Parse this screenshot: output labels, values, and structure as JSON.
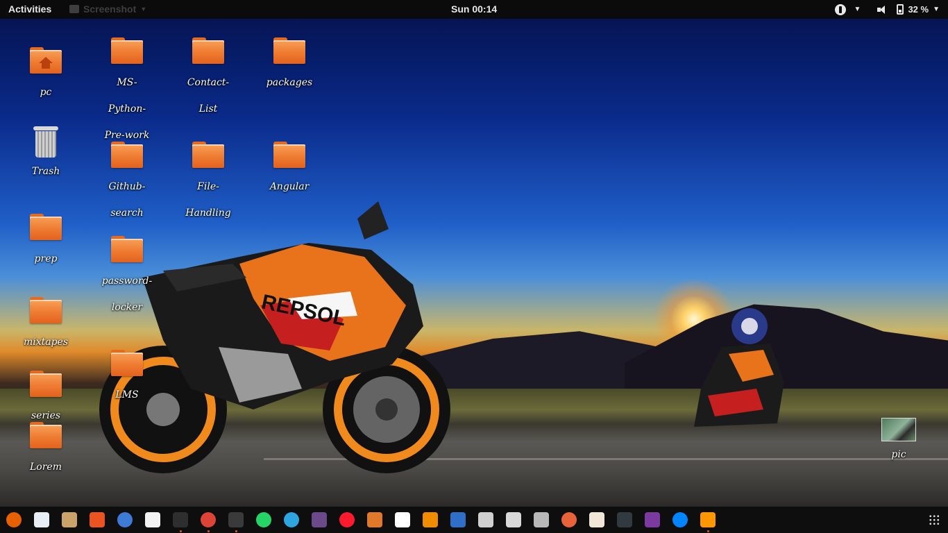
{
  "topbar": {
    "activities": "Activities",
    "app_menu": "Screenshot",
    "clock": "Sun 00:14",
    "battery": "32 %"
  },
  "desktop": {
    "icons": [
      {
        "label": "pc",
        "kind": "home-folder"
      },
      {
        "label": "Trash",
        "kind": "trash"
      },
      {
        "label": "prep",
        "kind": "folder"
      },
      {
        "label": "mixtapes",
        "kind": "folder"
      },
      {
        "label": "series",
        "kind": "folder"
      },
      {
        "label": "Lorem",
        "kind": "folder"
      },
      {
        "label": "MS-\nPython-\nPre-work",
        "kind": "folder"
      },
      {
        "label": "Github-\nsearch",
        "kind": "folder"
      },
      {
        "label": "password-\nlocker",
        "kind": "folder"
      },
      {
        "label": "LMS",
        "kind": "folder"
      },
      {
        "label": "Contact-\nList",
        "kind": "folder"
      },
      {
        "label": "File-\nHandling",
        "kind": "folder"
      },
      {
        "label": "packages",
        "kind": "folder"
      },
      {
        "label": "Angular",
        "kind": "folder"
      },
      {
        "label": "pic",
        "kind": "image"
      }
    ]
  },
  "dock": {
    "apps": [
      {
        "name": "firefox-icon",
        "color": "#e66000",
        "running": false
      },
      {
        "name": "document-viewer-icon",
        "color": "#e8eef6",
        "running": false
      },
      {
        "name": "files-cabinet-icon",
        "color": "#c9a36a",
        "running": false
      },
      {
        "name": "software-center-icon",
        "color": "#e95420",
        "running": false
      },
      {
        "name": "help-icon",
        "color": "#3d7bd6",
        "running": false
      },
      {
        "name": "amazon-icon",
        "color": "#f2f2f2",
        "running": false
      },
      {
        "name": "terminal-icon",
        "color": "#2e2e2e",
        "running": true
      },
      {
        "name": "chrome-icon",
        "color": "#db4437",
        "running": true
      },
      {
        "name": "video-editor-icon",
        "color": "#3a3a3a",
        "running": true
      },
      {
        "name": "whatsapp-icon",
        "color": "#25d366",
        "running": false
      },
      {
        "name": "telegram-icon",
        "color": "#2ca5e0",
        "running": false
      },
      {
        "name": "screen-recorder-icon",
        "color": "#6b4a8a",
        "running": false
      },
      {
        "name": "opera-icon",
        "color": "#ff1b2d",
        "running": false
      },
      {
        "name": "archive-icon",
        "color": "#e07a2a",
        "running": false
      },
      {
        "name": "solitaire-icon",
        "color": "#ffffff",
        "running": false
      },
      {
        "name": "vlc-icon",
        "color": "#f08c00",
        "running": false
      },
      {
        "name": "tasks-icon",
        "color": "#2f6fc8",
        "running": false
      },
      {
        "name": "camera-icon",
        "color": "#cfcfcf",
        "running": false
      },
      {
        "name": "scanner-icon",
        "color": "#d8d8d8",
        "running": false
      },
      {
        "name": "settings-icon",
        "color": "#b8b8b8",
        "running": false
      },
      {
        "name": "disk-usage-icon",
        "color": "#e8623a",
        "running": false
      },
      {
        "name": "text-editor-icon",
        "color": "#f2e6d6",
        "running": false
      },
      {
        "name": "system-monitor-icon",
        "color": "#303a40",
        "running": false
      },
      {
        "name": "video-player-icon",
        "color": "#7a3aa0",
        "running": false
      },
      {
        "name": "messenger-icon",
        "color": "#0084ff",
        "running": false
      },
      {
        "name": "sublime-text-icon",
        "color": "#ff9800",
        "running": true
      }
    ]
  }
}
